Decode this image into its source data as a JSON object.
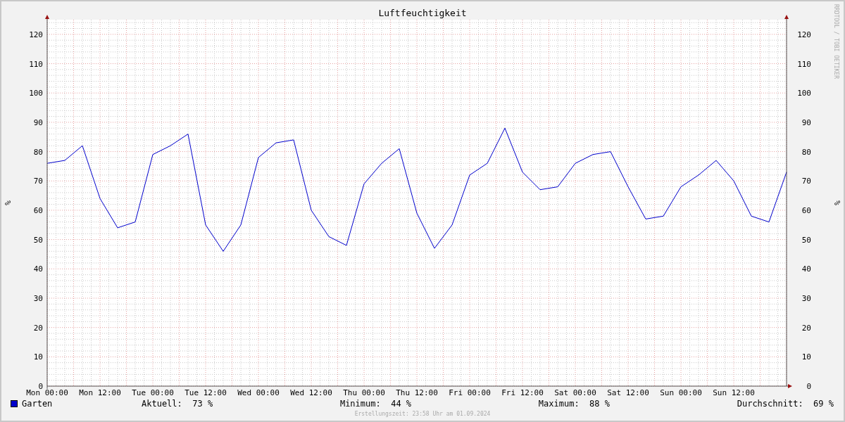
{
  "credit": "RRDTOOL / TOBI OETIKER",
  "chart_data": {
    "type": "line",
    "title": "Luftfeuchtigkeit",
    "ylabel": "%",
    "ylim": [
      0,
      125
    ],
    "y2lim": [
      0,
      125
    ],
    "grid": true,
    "yticks": [
      0,
      10,
      20,
      30,
      40,
      50,
      60,
      70,
      80,
      90,
      100,
      110,
      120
    ],
    "y2ticks": [
      0,
      10,
      20,
      30,
      40,
      50,
      60,
      70,
      80,
      90,
      100,
      110,
      120
    ],
    "categories": [
      "Mon 00:00",
      null,
      null,
      "Mon 12:00",
      null,
      null,
      "Tue 00:00",
      null,
      null,
      "Tue 12:00",
      null,
      null,
      "Wed 00:00",
      null,
      null,
      "Wed 12:00",
      null,
      null,
      "Thu 00:00",
      null,
      null,
      "Thu 12:00",
      null,
      null,
      "Fri 00:00",
      null,
      null,
      "Fri 12:00",
      null,
      null,
      "Sat 00:00",
      null,
      null,
      "Sat 12:00",
      null,
      null,
      "Sun 00:00",
      null,
      null,
      "Sun 12:00",
      null,
      null,
      null
    ],
    "series": [
      {
        "name": "Garten",
        "color": "#0000cc",
        "values": [
          76,
          77,
          82,
          64,
          54,
          56,
          79,
          82,
          86,
          55,
          46,
          55,
          78,
          83,
          84,
          60,
          51,
          48,
          69,
          76,
          81,
          59,
          47,
          55,
          72,
          76,
          88,
          73,
          67,
          68,
          76,
          79,
          80,
          68,
          57,
          58,
          68,
          72,
          77,
          70,
          58,
          56,
          73
        ]
      }
    ]
  },
  "legend": {
    "stats": [
      {
        "label": "Aktuell:",
        "value": "73 %"
      },
      {
        "label": "Minimum:",
        "value": "44 %"
      },
      {
        "label": "Maximum:",
        "value": "88 %"
      },
      {
        "label": "Durchschnitt:",
        "value": "69 %"
      }
    ]
  },
  "footer": "Erstellungszeit: 23:58 Uhr am 01.09.2024"
}
